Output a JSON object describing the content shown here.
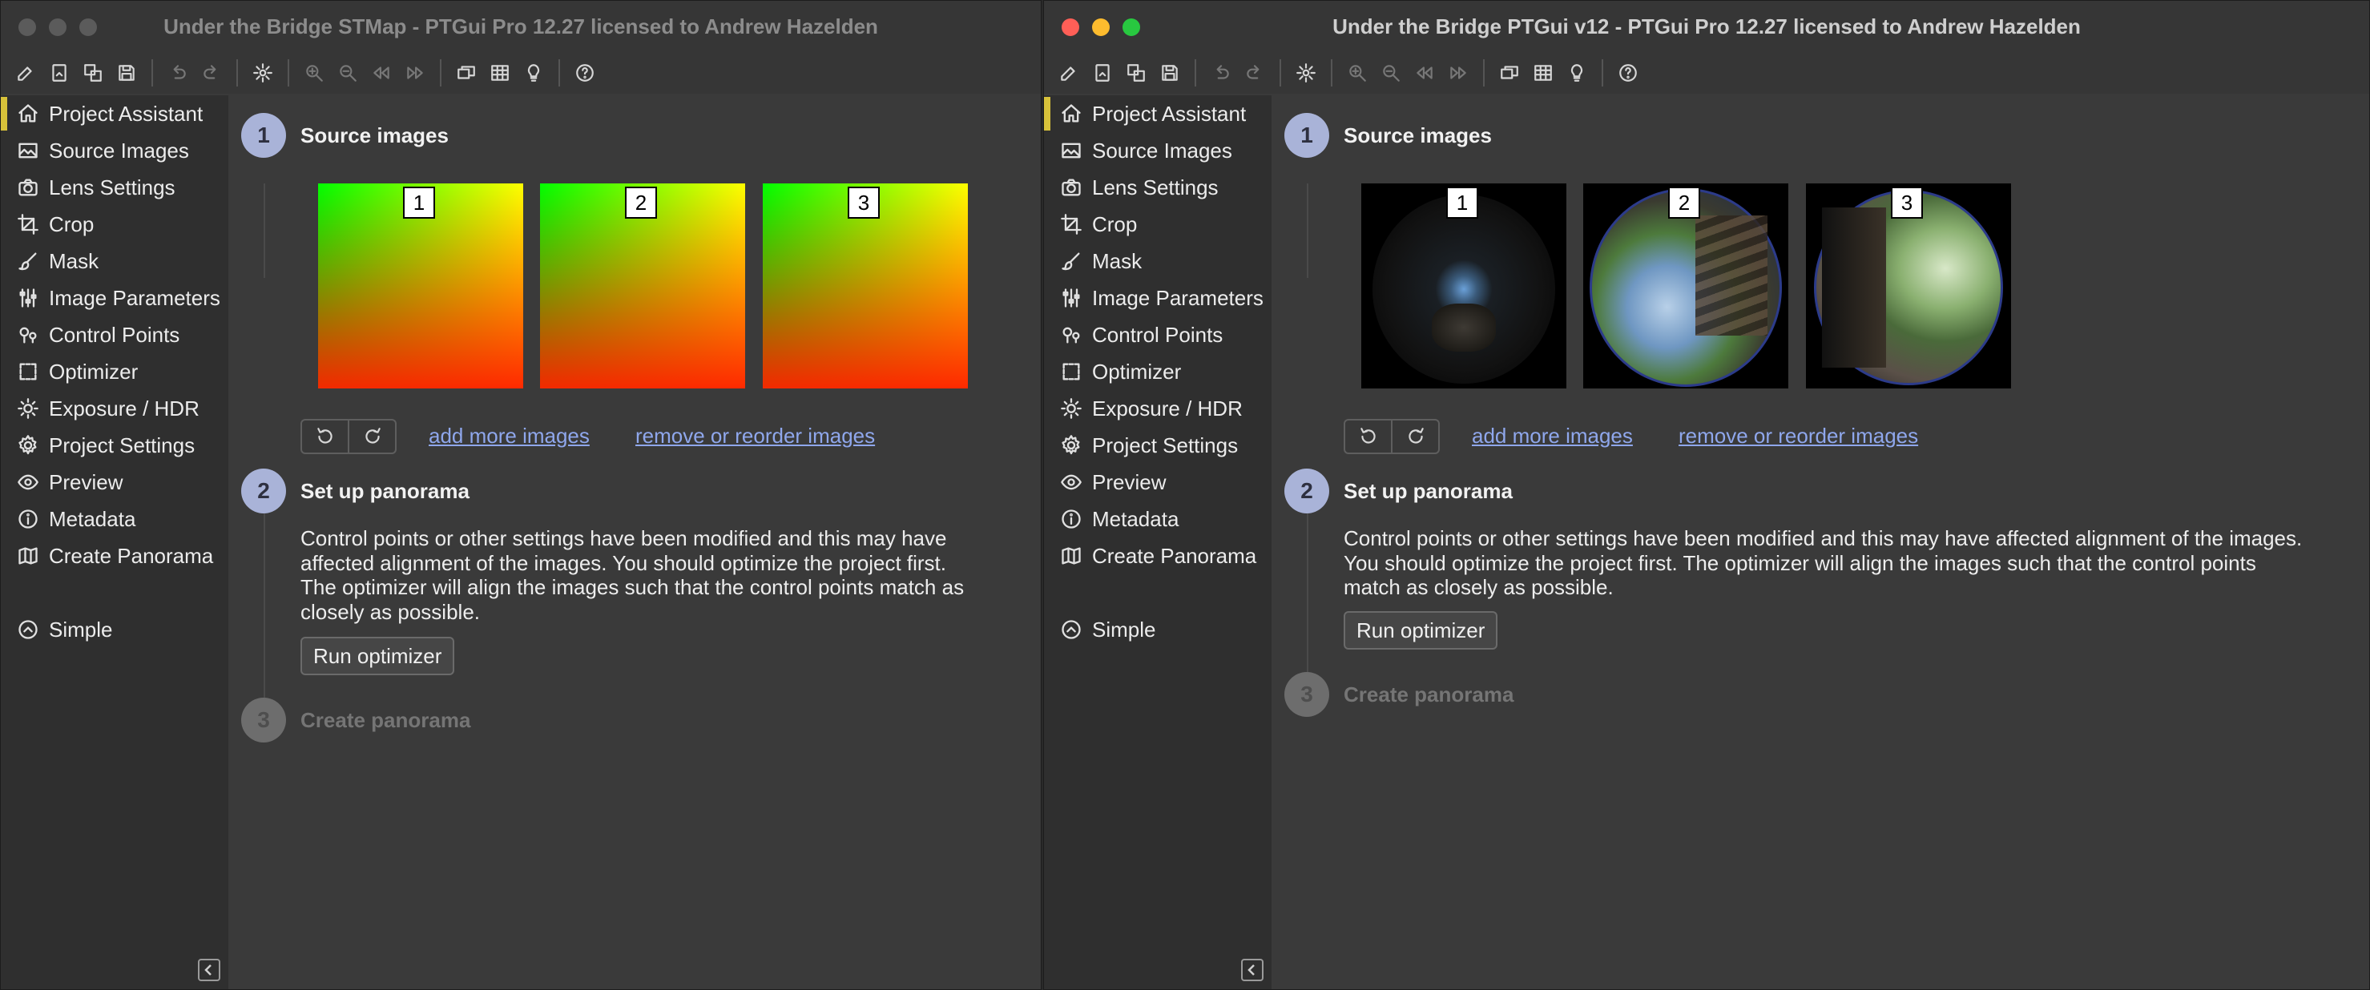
{
  "toolbar_icons": [
    "new-project-icon",
    "open-project-icon",
    "copy-icon",
    "save-icon",
    "undo-icon",
    "redo-icon",
    "settings-icon",
    "zoom-in-icon",
    "zoom-out-icon",
    "skip-back-icon",
    "skip-forward-icon",
    "panorama-editor-icon",
    "control-point-table-icon",
    "lightbulb-icon",
    "help-icon"
  ],
  "sidebar_items": [
    {
      "label": "Project Assistant",
      "icon": "home-icon"
    },
    {
      "label": "Source Images",
      "icon": "image-icon"
    },
    {
      "label": "Lens Settings",
      "icon": "camera-icon"
    },
    {
      "label": "Crop",
      "icon": "crop-icon"
    },
    {
      "label": "Mask",
      "icon": "brush-icon"
    },
    {
      "label": "Image Parameters",
      "icon": "sliders-icon"
    },
    {
      "label": "Control Points",
      "icon": "pin-icon"
    },
    {
      "label": "Optimizer",
      "icon": "optimizer-icon"
    },
    {
      "label": "Exposure / HDR",
      "icon": "sun-icon"
    },
    {
      "label": "Project Settings",
      "icon": "gear-icon"
    },
    {
      "label": "Preview",
      "icon": "eye-icon"
    },
    {
      "label": "Metadata",
      "icon": "info-icon"
    },
    {
      "label": "Create Panorama",
      "icon": "map-icon"
    }
  ],
  "simple_label": "Simple",
  "colors": {
    "accent": "#d8c23a",
    "link": "#8fa7ec",
    "step_circle": "#a9b3d8"
  },
  "windows": [
    {
      "title": "Under the Bridge STMap - PTGui Pro 12.27 licensed to Andrew Hazelden",
      "focused": false,
      "steps": {
        "s1": {
          "num": "1",
          "title": "Source images"
        },
        "s2": {
          "num": "2",
          "title": "Set up panorama"
        },
        "s3": {
          "num": "3",
          "title": "Create panorama"
        }
      },
      "thumbnails": [
        "1",
        "2",
        "3"
      ],
      "add_images_link": "add more images",
      "reorder_link": "remove or reorder images",
      "paragraph_lines": [
        "Control points or other settings have been modified and this may have",
        "affected alignment of the images. You should optimize the project first.",
        "The optimizer will align the images such that the control points match as",
        "closely as possible."
      ],
      "run_optimizer": "Run optimizer"
    },
    {
      "title": "Under the Bridge PTGui v12 - PTGui Pro 12.27 licensed to Andrew Hazelden",
      "focused": true,
      "steps": {
        "s1": {
          "num": "1",
          "title": "Source images"
        },
        "s2": {
          "num": "2",
          "title": "Set up panorama"
        },
        "s3": {
          "num": "3",
          "title": "Create panorama"
        }
      },
      "thumbnails": [
        "1",
        "2",
        "3"
      ],
      "add_images_link": "add more images",
      "reorder_link": "remove or reorder images",
      "paragraph_lines": [
        "Control points or other settings have been modified and this may have affected alignment of the images.",
        "You should optimize the project first. The optimizer will align the images such that the control points",
        "match as closely as possible."
      ],
      "run_optimizer": "Run optimizer"
    }
  ]
}
